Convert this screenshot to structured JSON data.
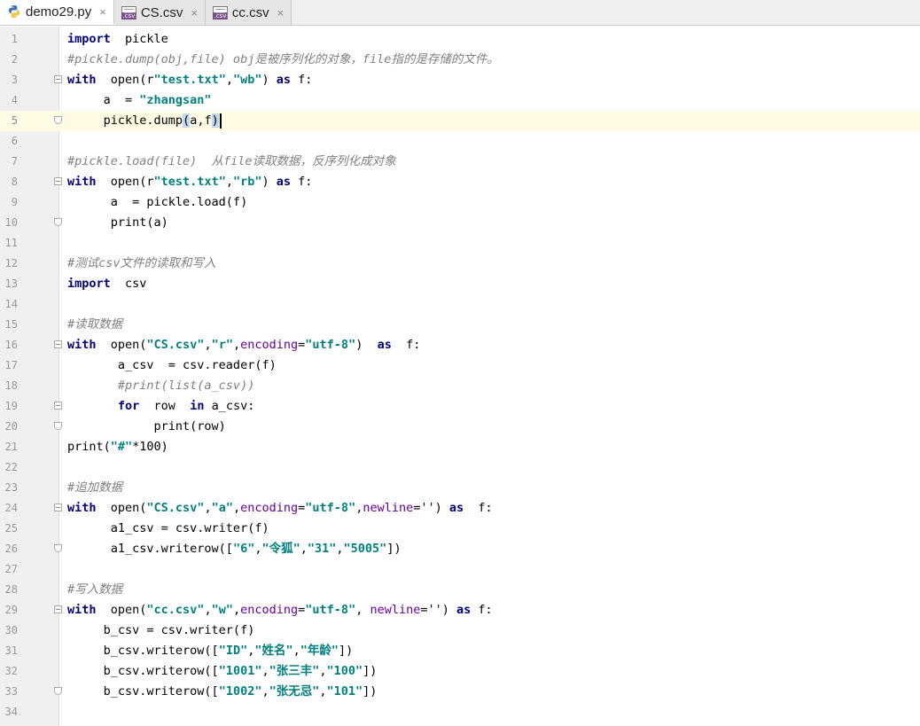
{
  "tabs": [
    {
      "label": "demo29.py",
      "icon": "python-file-icon",
      "active": true
    },
    {
      "label": "CS.csv",
      "icon": "csv-file-icon",
      "active": false
    },
    {
      "label": "cc.csv",
      "icon": "csv-file-icon",
      "active": false
    }
  ],
  "tab_close_glyph": "×",
  "csv_icon_text": ".csv",
  "current_line": 5,
  "lines": [
    {
      "n": "1",
      "fold": "",
      "tokens": [
        {
          "t": "kw",
          "v": "import"
        },
        {
          "t": "",
          "v": "  pickle"
        }
      ]
    },
    {
      "n": "2",
      "fold": "",
      "tokens": [
        {
          "t": "cm",
          "v": "#pickle.dump(obj,file) obj是被序列化的对象，file指的是存储的文件。"
        }
      ]
    },
    {
      "n": "3",
      "fold": "start",
      "tokens": [
        {
          "t": "kw",
          "v": "with"
        },
        {
          "t": "",
          "v": "  open(r"
        },
        {
          "t": "str",
          "v": "\"test.txt\""
        },
        {
          "t": "",
          "v": ","
        },
        {
          "t": "str",
          "v": "\"wb\""
        },
        {
          "t": "",
          "v": ") "
        },
        {
          "t": "kw",
          "v": "as"
        },
        {
          "t": "",
          "v": " f:"
        }
      ]
    },
    {
      "n": "4",
      "fold": "",
      "tokens": [
        {
          "t": "",
          "v": "     a  = "
        },
        {
          "t": "str",
          "v": "\"zhangsan\""
        }
      ]
    },
    {
      "n": "5",
      "fold": "end",
      "tokens": [
        {
          "t": "",
          "v": "     pickle.dump"
        },
        {
          "t": "sel",
          "v": "("
        },
        {
          "t": "",
          "v": "a,f"
        },
        {
          "t": "sel",
          "v": ")"
        },
        {
          "t": "caret",
          "v": ""
        }
      ]
    },
    {
      "n": "6",
      "fold": "",
      "tokens": []
    },
    {
      "n": "7",
      "fold": "",
      "tokens": [
        {
          "t": "cm",
          "v": "#pickle.load(file)  从file读取数据，反序列化成对象"
        }
      ]
    },
    {
      "n": "8",
      "fold": "start",
      "tokens": [
        {
          "t": "kw",
          "v": "with"
        },
        {
          "t": "",
          "v": "  open(r"
        },
        {
          "t": "str",
          "v": "\"test.txt\""
        },
        {
          "t": "",
          "v": ","
        },
        {
          "t": "str",
          "v": "\"rb\""
        },
        {
          "t": "",
          "v": ") "
        },
        {
          "t": "kw",
          "v": "as"
        },
        {
          "t": "",
          "v": " f:"
        }
      ]
    },
    {
      "n": "9",
      "fold": "",
      "tokens": [
        {
          "t": "",
          "v": "      a  = pickle.load(f)"
        }
      ]
    },
    {
      "n": "10",
      "fold": "end",
      "tokens": [
        {
          "t": "",
          "v": "      print(a)"
        }
      ]
    },
    {
      "n": "11",
      "fold": "",
      "tokens": []
    },
    {
      "n": "12",
      "fold": "",
      "tokens": [
        {
          "t": "cm",
          "v": "#测试csv文件的读取和写入"
        }
      ]
    },
    {
      "n": "13",
      "fold": "",
      "tokens": [
        {
          "t": "kw",
          "v": "import"
        },
        {
          "t": "",
          "v": "  csv"
        }
      ]
    },
    {
      "n": "14",
      "fold": "",
      "tokens": []
    },
    {
      "n": "15",
      "fold": "",
      "tokens": [
        {
          "t": "cm",
          "v": "#读取数据"
        }
      ]
    },
    {
      "n": "16",
      "fold": "start",
      "tokens": [
        {
          "t": "kw",
          "v": "with"
        },
        {
          "t": "",
          "v": "  open("
        },
        {
          "t": "str",
          "v": "\"CS.csv\""
        },
        {
          "t": "",
          "v": ","
        },
        {
          "t": "str",
          "v": "\"r\""
        },
        {
          "t": "",
          "v": ","
        },
        {
          "t": "kwarg",
          "v": "encoding"
        },
        {
          "t": "",
          "v": "="
        },
        {
          "t": "str",
          "v": "\"utf-8\""
        },
        {
          "t": "",
          "v": ")  "
        },
        {
          "t": "kw",
          "v": "as"
        },
        {
          "t": "",
          "v": "  f:"
        }
      ]
    },
    {
      "n": "17",
      "fold": "",
      "tokens": [
        {
          "t": "",
          "v": "       a_csv  = csv.reader(f)"
        }
      ]
    },
    {
      "n": "18",
      "fold": "",
      "tokens": [
        {
          "t": "cm",
          "v": "       #print(list(a_csv))"
        }
      ]
    },
    {
      "n": "19",
      "fold": "start",
      "tokens": [
        {
          "t": "",
          "v": "       "
        },
        {
          "t": "kw",
          "v": "for"
        },
        {
          "t": "",
          "v": "  row  "
        },
        {
          "t": "kw",
          "v": "in"
        },
        {
          "t": "",
          "v": " a_csv:"
        }
      ]
    },
    {
      "n": "20",
      "fold": "end",
      "tokens": [
        {
          "t": "",
          "v": "            print(row)"
        }
      ]
    },
    {
      "n": "21",
      "fold": "",
      "tokens": [
        {
          "t": "",
          "v": "print("
        },
        {
          "t": "str",
          "v": "\"#\""
        },
        {
          "t": "",
          "v": "*100)"
        }
      ]
    },
    {
      "n": "22",
      "fold": "",
      "tokens": []
    },
    {
      "n": "23",
      "fold": "",
      "tokens": [
        {
          "t": "cm",
          "v": "#追加数据"
        }
      ]
    },
    {
      "n": "24",
      "fold": "start",
      "tokens": [
        {
          "t": "kw",
          "v": "with"
        },
        {
          "t": "",
          "v": "  open("
        },
        {
          "t": "str",
          "v": "\"CS.csv\""
        },
        {
          "t": "",
          "v": ","
        },
        {
          "t": "str",
          "v": "\"a\""
        },
        {
          "t": "",
          "v": ","
        },
        {
          "t": "kwarg",
          "v": "encoding"
        },
        {
          "t": "",
          "v": "="
        },
        {
          "t": "str",
          "v": "\"utf-8\""
        },
        {
          "t": "",
          "v": ","
        },
        {
          "t": "kwarg",
          "v": "newline"
        },
        {
          "t": "",
          "v": "='') "
        },
        {
          "t": "kw",
          "v": "as"
        },
        {
          "t": "",
          "v": "  f:"
        }
      ]
    },
    {
      "n": "25",
      "fold": "",
      "tokens": [
        {
          "t": "",
          "v": "      a1_csv = csv.writer(f)"
        }
      ]
    },
    {
      "n": "26",
      "fold": "end",
      "tokens": [
        {
          "t": "",
          "v": "      a1_csv.writerow(["
        },
        {
          "t": "str",
          "v": "\"6\""
        },
        {
          "t": "",
          "v": ","
        },
        {
          "t": "str",
          "v": "\"令狐\""
        },
        {
          "t": "",
          "v": ","
        },
        {
          "t": "str",
          "v": "\"31\""
        },
        {
          "t": "",
          "v": ","
        },
        {
          "t": "str",
          "v": "\"5005\""
        },
        {
          "t": "",
          "v": "])"
        }
      ]
    },
    {
      "n": "27",
      "fold": "",
      "tokens": []
    },
    {
      "n": "28",
      "fold": "",
      "tokens": [
        {
          "t": "cm",
          "v": "#写入数据"
        }
      ]
    },
    {
      "n": "29",
      "fold": "start",
      "tokens": [
        {
          "t": "kw",
          "v": "with"
        },
        {
          "t": "",
          "v": "  open("
        },
        {
          "t": "str",
          "v": "\"cc.csv\""
        },
        {
          "t": "",
          "v": ","
        },
        {
          "t": "str",
          "v": "\"w\""
        },
        {
          "t": "",
          "v": ","
        },
        {
          "t": "kwarg",
          "v": "encoding"
        },
        {
          "t": "",
          "v": "="
        },
        {
          "t": "str",
          "v": "\"utf-8\""
        },
        {
          "t": "",
          "v": ", "
        },
        {
          "t": "kwarg",
          "v": "newline"
        },
        {
          "t": "",
          "v": "='') "
        },
        {
          "t": "kw",
          "v": "as"
        },
        {
          "t": "",
          "v": " f:"
        }
      ]
    },
    {
      "n": "30",
      "fold": "",
      "tokens": [
        {
          "t": "",
          "v": "     b_csv = csv.writer(f)"
        }
      ]
    },
    {
      "n": "31",
      "fold": "",
      "tokens": [
        {
          "t": "",
          "v": "     b_csv.writerow(["
        },
        {
          "t": "str",
          "v": "\"ID\""
        },
        {
          "t": "",
          "v": ","
        },
        {
          "t": "str",
          "v": "\"姓名\""
        },
        {
          "t": "",
          "v": ","
        },
        {
          "t": "str",
          "v": "\"年龄\""
        },
        {
          "t": "",
          "v": "])"
        }
      ]
    },
    {
      "n": "32",
      "fold": "",
      "tokens": [
        {
          "t": "",
          "v": "     b_csv.writerow(["
        },
        {
          "t": "str",
          "v": "\"1001\""
        },
        {
          "t": "",
          "v": ","
        },
        {
          "t": "str",
          "v": "\"张三丰\""
        },
        {
          "t": "",
          "v": ","
        },
        {
          "t": "str",
          "v": "\"100\""
        },
        {
          "t": "",
          "v": "])"
        }
      ]
    },
    {
      "n": "33",
      "fold": "end",
      "tokens": [
        {
          "t": "",
          "v": "     b_csv.writerow(["
        },
        {
          "t": "str",
          "v": "\"1002\""
        },
        {
          "t": "",
          "v": ","
        },
        {
          "t": "str",
          "v": "\"张无忌\""
        },
        {
          "t": "",
          "v": ","
        },
        {
          "t": "str",
          "v": "\"101\""
        },
        {
          "t": "",
          "v": "])"
        }
      ]
    },
    {
      "n": "34",
      "fold": "",
      "tokens": []
    }
  ]
}
